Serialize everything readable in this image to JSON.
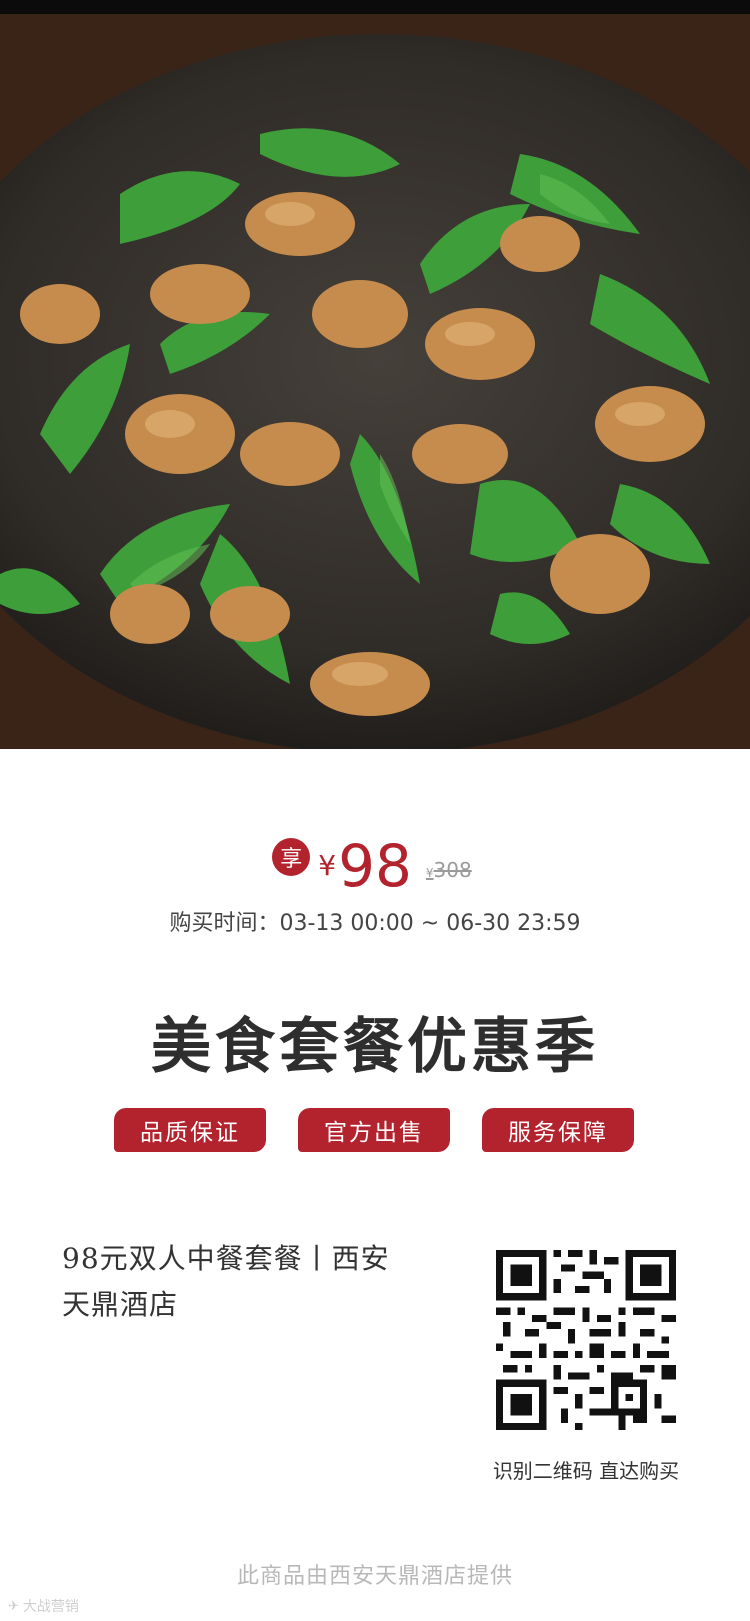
{
  "hero": {
    "image_icon": "dish-photo-icon",
    "description_colors": {
      "pepper": "#3a9a3a",
      "meat": "#c9904f",
      "plate": "#3a3530"
    }
  },
  "price": {
    "badge": "享",
    "currency": "¥",
    "current": "98",
    "original_currency": "¥",
    "original": "308"
  },
  "buy_time": "购买时间：03-13 00:00 ~ 06-30 23:59",
  "headline": "美食套餐优惠季",
  "tags": [
    "品质保证",
    "官方出售",
    "服务保障"
  ],
  "product": {
    "name": "98元双人中餐套餐丨西安天鼎酒店"
  },
  "qr": {
    "caption": "识别二维码 直达购买",
    "icon": "qr-code-icon"
  },
  "footer": "此商品由西安天鼎酒店提供",
  "watermark": "大战营销",
  "colors": {
    "accent": "#b3232e",
    "text": "#333333",
    "muted": "#b8b8b8"
  }
}
